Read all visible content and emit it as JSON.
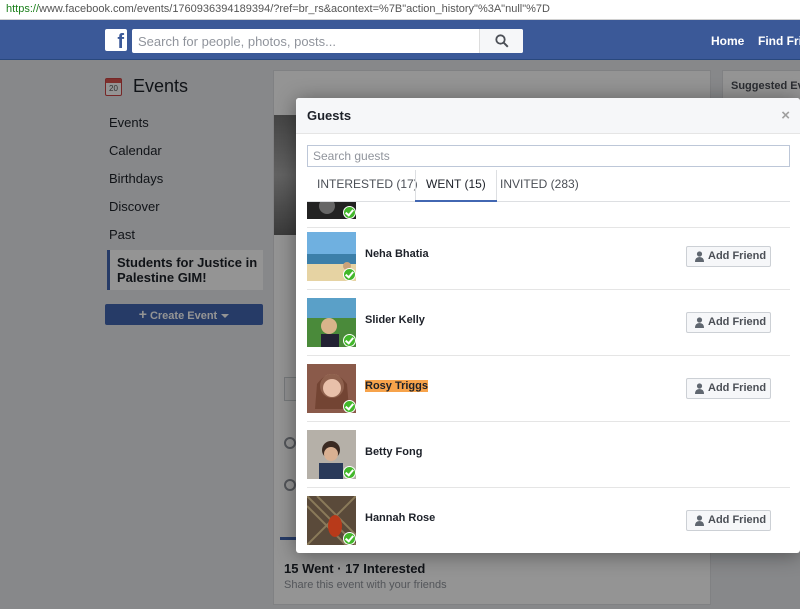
{
  "browser": {
    "url_scheme": "https://",
    "url_rest": "www.facebook.com/events/1760936394189394/?ref=br_rs&acontext=%7B\"action_history\"%3A\"null\"%7D"
  },
  "fb": {
    "logo": "f",
    "search_placeholder": "Search for people, photos, posts...",
    "nav": [
      "Home",
      "Find Frie"
    ]
  },
  "sidebar": {
    "title": "Events",
    "calendar_day": "20",
    "items": [
      "Events",
      "Calendar",
      "Birthdays",
      "Discover",
      "Past"
    ],
    "active_event": "Students for Justice in Palestine GIM!",
    "create_button": "Create Event"
  },
  "background": {
    "stats": "15 Went · 17 Interested",
    "share_text": "Share this event with your friends",
    "suggested": "Suggested Ev"
  },
  "modal": {
    "title": "Guests",
    "close_symbol": "×",
    "search_placeholder": "Search guests",
    "tabs": [
      "INTERESTED (17)",
      "WENT (15)",
      "INVITED (283)"
    ],
    "active_tab_index": 1,
    "add_friend_label": "Add Friend",
    "guests": [
      {
        "name": "Neha Bhatia",
        "add_friend": true,
        "highlighted": false
      },
      {
        "name": "Slider Kelly",
        "add_friend": true,
        "highlighted": false
      },
      {
        "name": "Rosy Triggs",
        "add_friend": true,
        "highlighted": true
      },
      {
        "name": "Betty Fong",
        "add_friend": false,
        "highlighted": false
      },
      {
        "name": "Hannah Rose",
        "add_friend": true,
        "highlighted": false
      }
    ]
  },
  "colors": {
    "fb_blue": "#3b5998",
    "button_blue": "#4267b2",
    "going_check": "#42b72a",
    "highlight": "#f7a34b"
  }
}
